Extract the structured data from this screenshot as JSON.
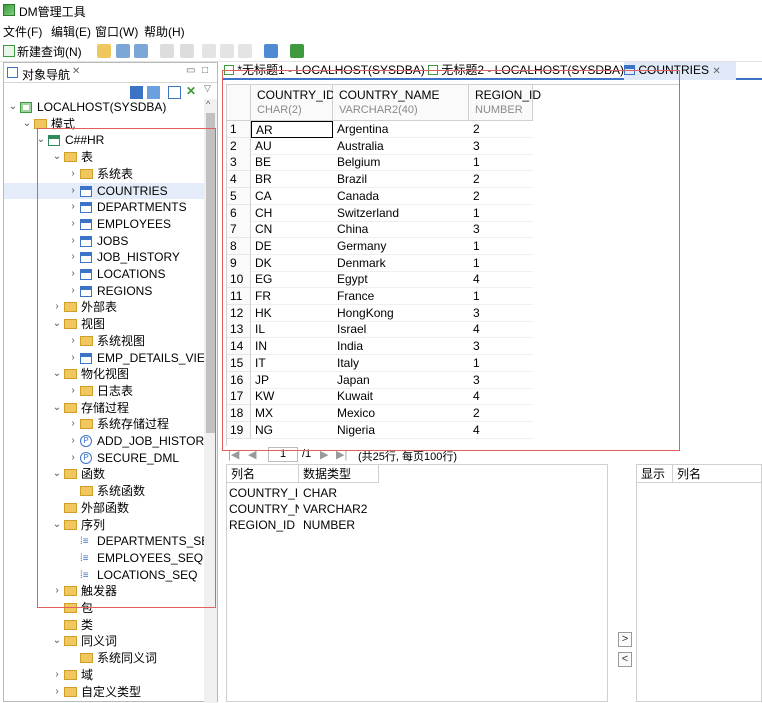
{
  "app": {
    "title": "DM管理工具"
  },
  "menu": [
    "文件(F)",
    "编辑(E)",
    "窗口(W)",
    "帮助(H)"
  ],
  "toolbar": {
    "new_query": "新建查询(N)"
  },
  "left_panel": {
    "tab_label": "对象导航"
  },
  "tree": [
    {
      "label": "LOCALHOST(SYSDBA)",
      "depth": 0,
      "icon": "server-icon",
      "arrow": "expanded"
    },
    {
      "label": "模式",
      "depth": 1,
      "icon": "folder-icon",
      "arrow": "expanded"
    },
    {
      "label": "C##HR",
      "depth": 2,
      "icon": "schema-icon",
      "arrow": "expanded"
    },
    {
      "label": "表",
      "depth": 3,
      "icon": "folder-icon",
      "arrow": "expanded"
    },
    {
      "label": "系统表",
      "depth": 4,
      "icon": "folder-icon",
      "arrow": "collapsed"
    },
    {
      "label": "COUNTRIES",
      "depth": 4,
      "icon": "table-icon",
      "arrow": "collapsed",
      "selected": true
    },
    {
      "label": "DEPARTMENTS",
      "depth": 4,
      "icon": "table-icon",
      "arrow": "collapsed"
    },
    {
      "label": "EMPLOYEES",
      "depth": 4,
      "icon": "table-icon",
      "arrow": "collapsed"
    },
    {
      "label": "JOBS",
      "depth": 4,
      "icon": "table-icon",
      "arrow": "collapsed"
    },
    {
      "label": "JOB_HISTORY",
      "depth": 4,
      "icon": "table-icon",
      "arrow": "collapsed"
    },
    {
      "label": "LOCATIONS",
      "depth": 4,
      "icon": "table-icon",
      "arrow": "collapsed"
    },
    {
      "label": "REGIONS",
      "depth": 4,
      "icon": "table-icon",
      "arrow": "collapsed"
    },
    {
      "label": "外部表",
      "depth": 3,
      "icon": "folder-icon",
      "arrow": "collapsed"
    },
    {
      "label": "视图",
      "depth": 3,
      "icon": "folder-icon",
      "arrow": "expanded"
    },
    {
      "label": "系统视图",
      "depth": 4,
      "icon": "folder-icon",
      "arrow": "collapsed"
    },
    {
      "label": "EMP_DETAILS_VIEW",
      "depth": 4,
      "icon": "view-icon",
      "arrow": "collapsed"
    },
    {
      "label": "物化视图",
      "depth": 3,
      "icon": "folder-icon",
      "arrow": "expanded"
    },
    {
      "label": "日志表",
      "depth": 4,
      "icon": "folder-icon",
      "arrow": "collapsed"
    },
    {
      "label": "存储过程",
      "depth": 3,
      "icon": "folder-icon",
      "arrow": "expanded"
    },
    {
      "label": "系统存储过程",
      "depth": 4,
      "icon": "folder-icon",
      "arrow": "collapsed"
    },
    {
      "label": "ADD_JOB_HISTORY",
      "depth": 4,
      "icon": "procedure-icon",
      "arrow": "collapsed"
    },
    {
      "label": "SECURE_DML",
      "depth": 4,
      "icon": "procedure-icon",
      "arrow": "collapsed"
    },
    {
      "label": "函数",
      "depth": 3,
      "icon": "folder-icon",
      "arrow": "expanded"
    },
    {
      "label": "系统函数",
      "depth": 4,
      "icon": "folder-icon",
      "arrow": "none"
    },
    {
      "label": "外部函数",
      "depth": 3,
      "icon": "folder-icon",
      "arrow": "none"
    },
    {
      "label": "序列",
      "depth": 3,
      "icon": "folder-icon",
      "arrow": "expanded"
    },
    {
      "label": "DEPARTMENTS_SEQ",
      "depth": 4,
      "icon": "sequence-icon",
      "arrow": "none"
    },
    {
      "label": "EMPLOYEES_SEQ",
      "depth": 4,
      "icon": "sequence-icon",
      "arrow": "none"
    },
    {
      "label": "LOCATIONS_SEQ",
      "depth": 4,
      "icon": "sequence-icon",
      "arrow": "none"
    },
    {
      "label": "触发器",
      "depth": 3,
      "icon": "folder-icon",
      "arrow": "collapsed"
    },
    {
      "label": "包",
      "depth": 3,
      "icon": "folder-icon",
      "arrow": "none"
    },
    {
      "label": "类",
      "depth": 3,
      "icon": "folder-icon",
      "arrow": "none"
    },
    {
      "label": "同义词",
      "depth": 3,
      "icon": "folder-icon",
      "arrow": "expanded"
    },
    {
      "label": "系统同义词",
      "depth": 4,
      "icon": "folder-icon",
      "arrow": "none"
    },
    {
      "label": "域",
      "depth": 3,
      "icon": "folder-icon",
      "arrow": "collapsed"
    },
    {
      "label": "自定义类型",
      "depth": 3,
      "icon": "folder-icon",
      "arrow": "collapsed"
    }
  ],
  "editor_tabs": [
    {
      "label": "*无标题1 - LOCALHOST(SYSDBA)"
    },
    {
      "label": "无标题2 - LOCALHOST(SYSDBA)"
    },
    {
      "label": "COUNTRIES",
      "active": true
    }
  ],
  "grid": {
    "columns": [
      {
        "name": "COUNTRY_ID",
        "type": "CHAR(2)"
      },
      {
        "name": "COUNTRY_NAME",
        "type": "VARCHAR2(40)"
      },
      {
        "name": "REGION_ID",
        "type": "NUMBER"
      }
    ],
    "rows": [
      [
        "AR",
        "Argentina",
        "2"
      ],
      [
        "AU",
        "Australia",
        "3"
      ],
      [
        "BE",
        "Belgium",
        "1"
      ],
      [
        "BR",
        "Brazil",
        "2"
      ],
      [
        "CA",
        "Canada",
        "2"
      ],
      [
        "CH",
        "Switzerland",
        "1"
      ],
      [
        "CN",
        "China",
        "3"
      ],
      [
        "DE",
        "Germany",
        "1"
      ],
      [
        "DK",
        "Denmark",
        "1"
      ],
      [
        "EG",
        "Egypt",
        "4"
      ],
      [
        "FR",
        "France",
        "1"
      ],
      [
        "HK",
        "HongKong",
        "3"
      ],
      [
        "IL",
        "Israel",
        "4"
      ],
      [
        "IN",
        "India",
        "3"
      ],
      [
        "IT",
        "Italy",
        "1"
      ],
      [
        "JP",
        "Japan",
        "3"
      ],
      [
        "KW",
        "Kuwait",
        "4"
      ],
      [
        "MX",
        "Mexico",
        "2"
      ],
      [
        "NG",
        "Nigeria",
        "4"
      ]
    ]
  },
  "pager": {
    "page": "1",
    "total_pages": "/1",
    "summary": "(共25行, 每页100行)"
  },
  "column_panel": {
    "headers": [
      "列名",
      "数据类型"
    ],
    "rows": [
      [
        "COUNTRY_ID",
        "CHAR"
      ],
      [
        "COUNTRY_NAME",
        "VARCHAR2"
      ],
      [
        "REGION_ID",
        "NUMBER"
      ]
    ],
    "move_right": ">",
    "move_left": "<"
  },
  "right_panel": {
    "headers": [
      "显示",
      "列名"
    ]
  }
}
